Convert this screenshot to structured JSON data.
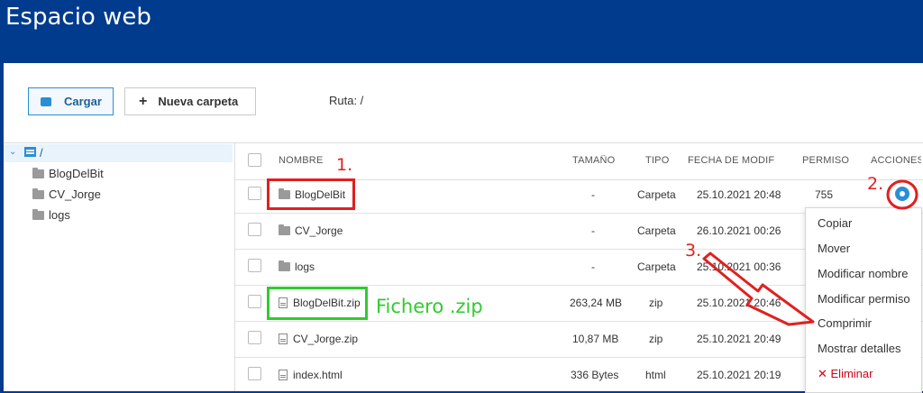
{
  "header": {
    "title": "Espacio web"
  },
  "toolbar": {
    "upload_label": "Cargar",
    "new_folder_plus": "+",
    "new_folder_label": "Nueva carpeta"
  },
  "path": {
    "label": "Ruta: /"
  },
  "tree": {
    "root": "/",
    "items": [
      "BlogDelBit",
      "CV_Jorge",
      "logs"
    ]
  },
  "table": {
    "columns": [
      "NOMBRE",
      "TAMAÑO",
      "TIPO",
      "FECHA DE MODIFICACIÓN",
      "PERMISO",
      "ACCIONES"
    ],
    "rows": [
      {
        "name": "BlogDelBit",
        "size": "-",
        "type": "Carpeta",
        "date": "25.10.2021 20:48",
        "perm": "755"
      },
      {
        "name": "CV_Jorge",
        "size": "-",
        "type": "Carpeta",
        "date": "26.10.2021 00:26",
        "perm": ""
      },
      {
        "name": "logs",
        "size": "-",
        "type": "Carpeta",
        "date": "25.10.2021 00:36",
        "perm": ""
      },
      {
        "name": "BlogDelBit.zip",
        "size": "263,24 MB",
        "type": "zip",
        "date": "25.10.2021 20:46",
        "perm": ""
      },
      {
        "name": "CV_Jorge.zip",
        "size": "10,87 MB",
        "type": "zip",
        "date": "25.10.2021 20:49",
        "perm": ""
      },
      {
        "name": "index.html",
        "size": "336 Bytes",
        "type": "html",
        "date": "25.10.2021 20:19",
        "perm": ""
      }
    ]
  },
  "context_menu": {
    "items": [
      "Copiar",
      "Mover",
      "Modificar nombre",
      "Modificar permiso",
      "Comprimir",
      "Mostrar detalles"
    ],
    "delete": "✕ Eliminar"
  },
  "annotations": {
    "n1": "1.",
    "n2": "2.",
    "n3": "3.",
    "zip_note": "Fichero .zip"
  },
  "colors": {
    "brand": "#003b8e",
    "accent": "#2a8ed6",
    "annotation_red": "#e02020",
    "annotation_green": "#2ecc2e",
    "danger": "#d0021b"
  }
}
